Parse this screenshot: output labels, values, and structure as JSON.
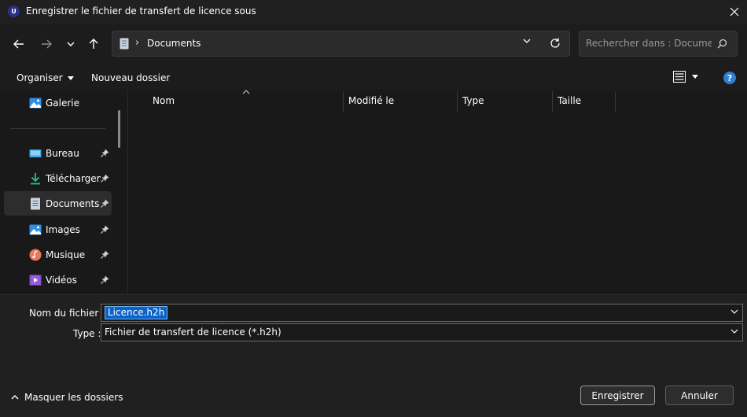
{
  "window": {
    "title": "Enregistrer le fichier de transfert de licence sous",
    "app_icon_letter": "U"
  },
  "address_bar": {
    "separator": "›",
    "current_folder": "Documents"
  },
  "search": {
    "placeholder": "Rechercher dans : Docume..."
  },
  "command_bar": {
    "organiser_label": "Organiser",
    "new_folder_label": "Nouveau dossier",
    "help_label": "?"
  },
  "sidebar": {
    "items": [
      {
        "label": "Galerie",
        "icon": "gallery-icon",
        "pinned": false
      },
      {
        "label": "Bureau",
        "icon": "desktop-icon",
        "pinned": true
      },
      {
        "label": "Téléchargem",
        "icon": "download-icon",
        "pinned": true
      },
      {
        "label": "Documents",
        "icon": "document-icon",
        "pinned": true,
        "selected": true
      },
      {
        "label": "Images",
        "icon": "images-icon",
        "pinned": true
      },
      {
        "label": "Musique",
        "icon": "music-icon",
        "pinned": true
      },
      {
        "label": "Vidéos",
        "icon": "videos-icon",
        "pinned": true
      }
    ]
  },
  "file_list": {
    "columns": [
      "Nom",
      "Modifié le",
      "Type",
      "Taille"
    ]
  },
  "form": {
    "filename_label": "Nom du fichier :",
    "filename_value": "Licence.h2h",
    "type_label": "Type :",
    "type_value": "Fichier de transfert de licence (*.h2h)"
  },
  "footer": {
    "hide_folders_label": "Masquer les dossiers",
    "save_label": "Enregistrer",
    "cancel_label": "Annuler"
  },
  "colors": {
    "accent": "#0a64c8",
    "background": "#1c1c1c",
    "help_icon": "#2f7fd6"
  }
}
